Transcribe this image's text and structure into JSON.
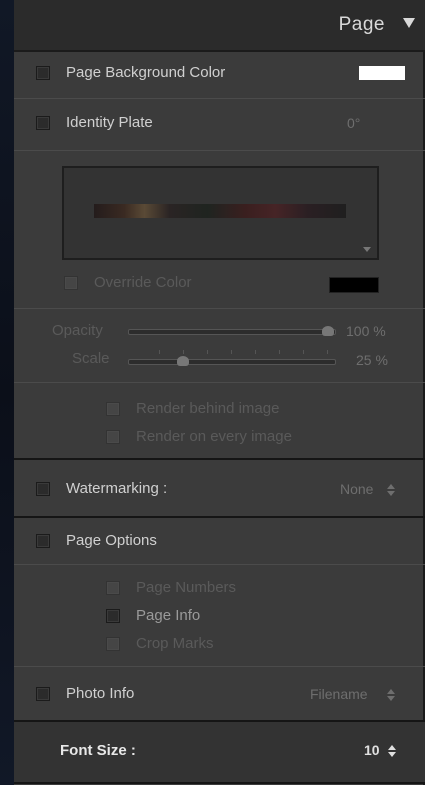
{
  "panel": {
    "title": "Page"
  },
  "page_background": {
    "label": "Page Background Color",
    "swatch_color": "#ffffff"
  },
  "identity_plate": {
    "label": "Identity Plate",
    "rotation": "0°",
    "override_color_label": "Override Color",
    "override_swatch_color": "#000000",
    "opacity_label": "Opacity",
    "opacity_value": "100",
    "opacity_unit": "%",
    "opacity_fraction": 1.0,
    "scale_label": "Scale",
    "scale_value": "25",
    "scale_unit": "%",
    "scale_fraction": 0.25,
    "render_behind_label": "Render behind image",
    "render_every_label": "Render on every image"
  },
  "watermarking": {
    "label": "Watermarking :",
    "value": "None"
  },
  "page_options": {
    "label": "Page Options",
    "items": [
      {
        "label": "Page Numbers"
      },
      {
        "label": "Page Info"
      },
      {
        "label": "Crop Marks"
      }
    ]
  },
  "photo_info": {
    "label": "Photo Info",
    "value": "Filename"
  },
  "font_size": {
    "label": "Font Size :",
    "value": "10"
  }
}
